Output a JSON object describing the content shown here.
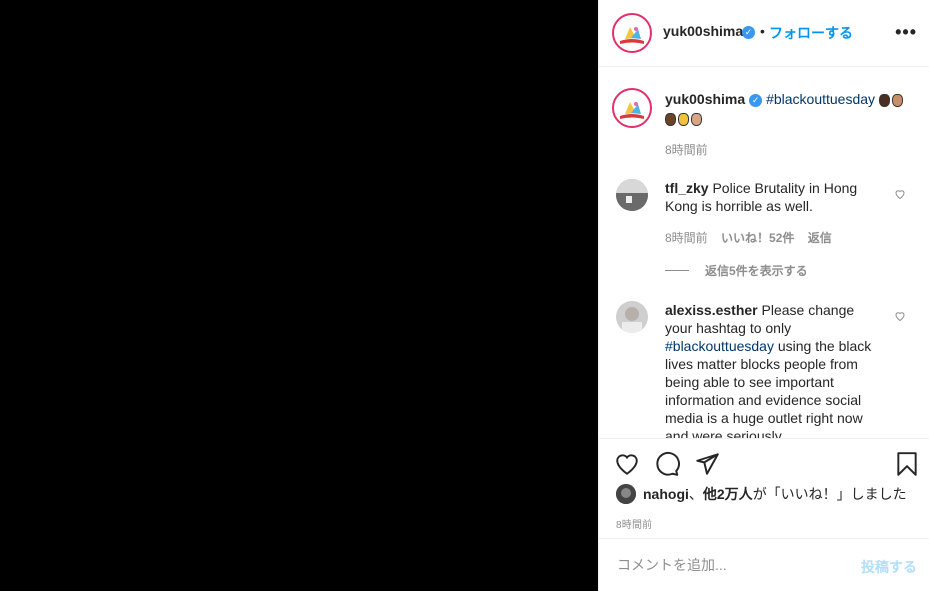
{
  "header": {
    "username": "yuk00shima",
    "separator": "•",
    "follow_label": "フォローする",
    "more_label": "•••"
  },
  "caption": {
    "username": "yuk00shima",
    "hashtag": "#blackouttuesday",
    "time": "8時間前"
  },
  "comments": [
    {
      "username": "tfl_zky",
      "text": "Police Brutality in Hong Kong is horrible as well.",
      "time": "8時間前",
      "likes": "いいね！52件",
      "reply": "返信",
      "view_replies": "返信5件を表示する"
    },
    {
      "username": "alexiss.esther",
      "text_before": "Please change your hashtag to only ",
      "hashtag": "#blackouttuesday",
      "text_after": " using the black lives matter blocks people from being able to see important information and evidence social media is a huge outlet right now and were seriously"
    }
  ],
  "likes_line": {
    "user": "nahogi",
    "text_mid": "、",
    "others": "他2万人",
    "text_end": "が「いいね！」しました"
  },
  "post_time": "8時間前",
  "comment_box": {
    "placeholder": "コメントを追加...",
    "post_label": "投稿する"
  },
  "colors": {
    "accent_blue": "#0095f6",
    "hashtag": "#00376b",
    "verified": "#3897f0",
    "muted": "#8e8e8e",
    "post_disabled": "#b2dffc"
  }
}
